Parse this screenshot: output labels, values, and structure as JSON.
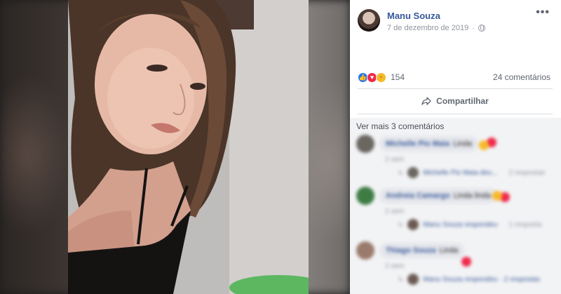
{
  "post": {
    "author": "Manu Souza",
    "date": "7 de dezembro de 2019",
    "privacy_icon": "globe-icon",
    "more_icon": "more-options-icon"
  },
  "reactions": {
    "icons": [
      "like-icon",
      "love-icon",
      "wow-icon"
    ],
    "count": "154",
    "comments": "24 comentários"
  },
  "actions": {
    "share_label": "Compartilhar"
  },
  "comments_section": {
    "view_more": "Ver mais 3 comentários",
    "items": [
      {
        "name": "Michelle Pio Maia",
        "text": "Linda",
        "time": "2 sem",
        "reply_by": "Michelle Pio Maia deu...",
        "reply_count": "2 respostas"
      },
      {
        "name": "Andreia Camargo",
        "text": "Linda linda",
        "time": "2 sem",
        "reply_by": "Manu Souza respondeu",
        "reply_count": "1 resposta"
      },
      {
        "name": "Thiago Souza",
        "text": "Linda",
        "time": "2 sem",
        "reply_by": "Manu Souza respondeu · 2 respostas",
        "reply_count": ""
      }
    ]
  },
  "colors": {
    "link": "#365899",
    "meta": "#90949c",
    "like": "#2078f4",
    "love": "#f0284a",
    "wow": "#f7b928",
    "comments_bg": "#f2f3f5"
  }
}
